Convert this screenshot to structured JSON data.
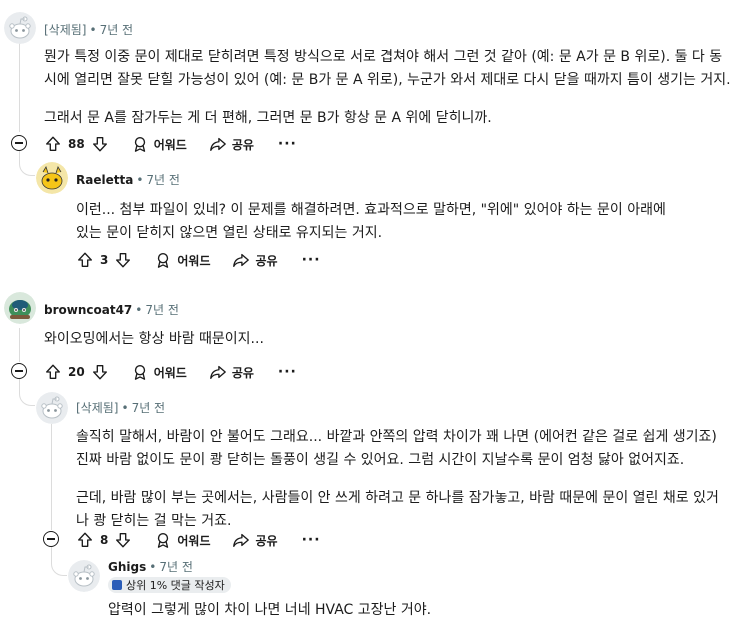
{
  "comments": [
    {
      "author": "[삭제됨]",
      "time": "7년 전",
      "paragraphs": [
        "뭔가 특정 이중 문이 제대로 닫히려면 특정 방식으로 서로 겹쳐야 해서 그런 것 같아 (예: 문 A가 문 B 위로). 둘 다 동시에 열리면 잘못 닫힐 가능성이 있어 (예: 문 B가 문 A 위로), 누군가 와서 제대로 다시 닫을 때까지 틈이 생기는 거지.",
        "그래서 문 A를 잠가두는 게 더 편해, 그러면 문 B가 항상 문 A 위에 닫히니까."
      ],
      "votes": "88"
    },
    {
      "author": "Raeletta",
      "time": "7년 전",
      "paragraphs": [
        "이런... 첨부 파일이 있네? 이 문제를 해결하려면. 효과적으로 말하면, \"위에\" 있어야 하는 문이 아래에 있는 문이 닫히지 않으면 열린 상태로 유지되는 거지."
      ],
      "votes": "3"
    },
    {
      "author": "browncoat47",
      "time": "7년 전",
      "paragraphs": [
        "와이오밍에서는 항상 바람 때문이지..."
      ],
      "votes": "20"
    },
    {
      "author": "[삭제됨]",
      "time": "7년 전",
      "paragraphs": [
        "솔직히 말해서, 바람이 안 불어도 그래요... 바깥과 안쪽의 압력 차이가 꽤 나면 (에어컨 같은 걸로 쉽게 생기죠) 진짜 바람 없이도 문이 쾅 닫히는 돌풍이 생길 수 있어요. 그럼 시간이 지날수록 문이 엄청 닳아 없어지죠.",
        "근데, 바람 많이 부는 곳에서는, 사람들이 안 쓰게 하려고 문 하나를 잠가놓고, 바람 때문에 문이 열린 채로 있거나 쾅 닫히는 걸 막는 거죠."
      ],
      "votes": "8"
    },
    {
      "author": "Ghigs",
      "time": "7년 전",
      "flair": "상위 1% 댓글 작성자",
      "paragraphs": [
        "압력이 그렇게 많이 차이 나면 너네 HVAC 고장난 거야."
      ]
    }
  ],
  "labels": {
    "award": "어워드",
    "share": "공유",
    "more": "···"
  },
  "colors": {
    "thread_line": "#dcdcdc",
    "meta_text": "#576f76",
    "badge_bg": "#eaedef"
  },
  "icons": [
    "snoo-avatar-icon",
    "upvote-icon",
    "downvote-icon",
    "award-icon",
    "share-icon",
    "collapse-icon"
  ]
}
